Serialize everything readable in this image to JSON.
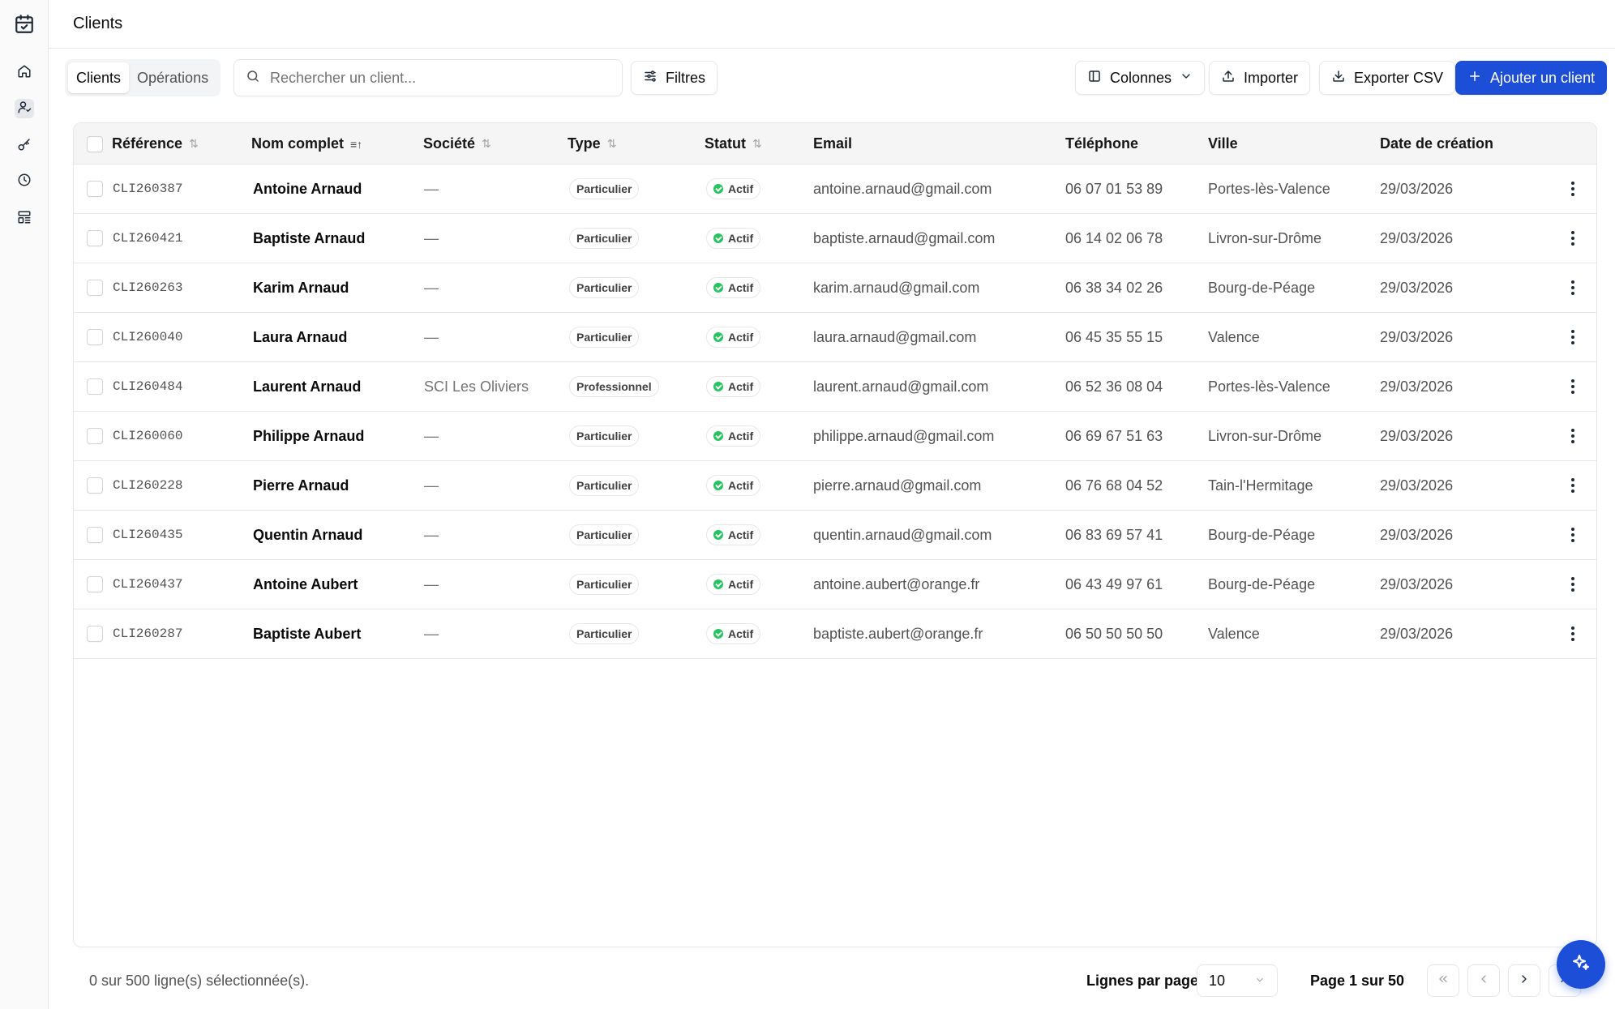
{
  "header": {
    "title": "Clients"
  },
  "sidebar": {
    "items": [
      {
        "name": "home",
        "icon": "home-icon"
      },
      {
        "name": "clients",
        "icon": "users-icon"
      },
      {
        "name": "keys",
        "icon": "key-icon"
      },
      {
        "name": "history",
        "icon": "clock-icon"
      },
      {
        "name": "layout",
        "icon": "layout-icon"
      }
    ],
    "logo_icon": "calendar-check-icon"
  },
  "toolbar": {
    "tabs": [
      {
        "label": "Clients",
        "active": true
      },
      {
        "label": "Opérations",
        "active": false
      }
    ],
    "search_placeholder": "Rechercher un client...",
    "filters_label": "Filtres",
    "columns_label": "Colonnes",
    "import_label": "Importer",
    "export_label": "Exporter CSV",
    "add_label": "Ajouter un client"
  },
  "table": {
    "columns": {
      "reference": "Référence",
      "name": "Nom complet",
      "company": "Société",
      "type": "Type",
      "status": "Statut",
      "email": "Email",
      "phone": "Téléphone",
      "city": "Ville",
      "created": "Date de création"
    },
    "rows": [
      {
        "ref": "CLI260387",
        "name": "Antoine Arnaud",
        "company": "—",
        "type": "Particulier",
        "status": "Actif",
        "email": "antoine.arnaud@gmail.com",
        "phone": "06 07 01 53 89",
        "city": "Portes-lès-Valence",
        "created": "29/03/2026"
      },
      {
        "ref": "CLI260421",
        "name": "Baptiste Arnaud",
        "company": "—",
        "type": "Particulier",
        "status": "Actif",
        "email": "baptiste.arnaud@gmail.com",
        "phone": "06 14 02 06 78",
        "city": "Livron-sur-Drôme",
        "created": "29/03/2026"
      },
      {
        "ref": "CLI260263",
        "name": "Karim Arnaud",
        "company": "—",
        "type": "Particulier",
        "status": "Actif",
        "email": "karim.arnaud@gmail.com",
        "phone": "06 38 34 02 26",
        "city": "Bourg-de-Péage",
        "created": "29/03/2026"
      },
      {
        "ref": "CLI260040",
        "name": "Laura Arnaud",
        "company": "—",
        "type": "Particulier",
        "status": "Actif",
        "email": "laura.arnaud@gmail.com",
        "phone": "06 45 35 55 15",
        "city": "Valence",
        "created": "29/03/2026"
      },
      {
        "ref": "CLI260484",
        "name": "Laurent Arnaud",
        "company": "SCI Les Oliviers",
        "type": "Professionnel",
        "status": "Actif",
        "email": "laurent.arnaud@gmail.com",
        "phone": "06 52 36 08 04",
        "city": "Portes-lès-Valence",
        "created": "29/03/2026"
      },
      {
        "ref": "CLI260060",
        "name": "Philippe Arnaud",
        "company": "—",
        "type": "Particulier",
        "status": "Actif",
        "email": "philippe.arnaud@gmail.com",
        "phone": "06 69 67 51 63",
        "city": "Livron-sur-Drôme",
        "created": "29/03/2026"
      },
      {
        "ref": "CLI260228",
        "name": "Pierre Arnaud",
        "company": "—",
        "type": "Particulier",
        "status": "Actif",
        "email": "pierre.arnaud@gmail.com",
        "phone": "06 76 68 04 52",
        "city": "Tain-l'Hermitage",
        "created": "29/03/2026"
      },
      {
        "ref": "CLI260435",
        "name": "Quentin Arnaud",
        "company": "—",
        "type": "Particulier",
        "status": "Actif",
        "email": "quentin.arnaud@gmail.com",
        "phone": "06 83 69 57 41",
        "city": "Bourg-de-Péage",
        "created": "29/03/2026"
      },
      {
        "ref": "CLI260437",
        "name": "Antoine Aubert",
        "company": "—",
        "type": "Particulier",
        "status": "Actif",
        "email": "antoine.aubert@orange.fr",
        "phone": "06 43 49 97 61",
        "city": "Bourg-de-Péage",
        "created": "29/03/2026"
      },
      {
        "ref": "CLI260287",
        "name": "Baptiste Aubert",
        "company": "—",
        "type": "Particulier",
        "status": "Actif",
        "email": "baptiste.aubert@orange.fr",
        "phone": "06 50 50 50 50",
        "city": "Valence",
        "created": "29/03/2026"
      }
    ]
  },
  "footer": {
    "selection": "0 sur 500 ligne(s) sélectionnée(s).",
    "rows_per_page_label": "Lignes par page",
    "rows_per_page_value": "10",
    "page_info": "Page 1 sur 50"
  },
  "colors": {
    "primary": "#1d4ed8",
    "status_active": "#22c55e"
  }
}
